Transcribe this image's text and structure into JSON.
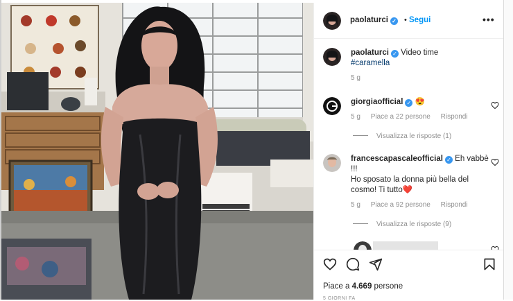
{
  "post": {
    "author": "paolaturci",
    "follow_label": "Segui",
    "separator": "•",
    "more_label": "•••"
  },
  "caption": {
    "author": "paolaturci",
    "text": "Video time",
    "hashtag": "#caramella",
    "time": "5 g"
  },
  "comments": [
    {
      "author": "giorgiaofficial",
      "text": "😍",
      "time": "5 g",
      "likes": "Piace a 22 persone",
      "reply": "Rispondi",
      "view_replies": "Visualizza le risposte (1)"
    },
    {
      "author": "francescapascaleofficial",
      "text": "Eh vabbè !!!",
      "text2": "Ho sposato la donna più bella del cosmo! Ti tutto",
      "heart": "❤️",
      "time": "5 g",
      "likes": "Piace a 92 persone",
      "reply": "Rispondi",
      "view_replies": "Visualizza le risposte (9)"
    }
  ],
  "footer": {
    "likes_prefix": "Piace a",
    "likes_count": "4.669",
    "likes_suffix": "persone",
    "date": "5 GIORNI FA"
  },
  "colors": {
    "accent": "#0095f6",
    "verified": "#3897f0",
    "muted": "#8e8e8e",
    "text": "#262626"
  },
  "icons": [
    "heart-icon",
    "comment-icon",
    "share-icon",
    "bookmark-icon",
    "verified-icon",
    "more-icon"
  ]
}
